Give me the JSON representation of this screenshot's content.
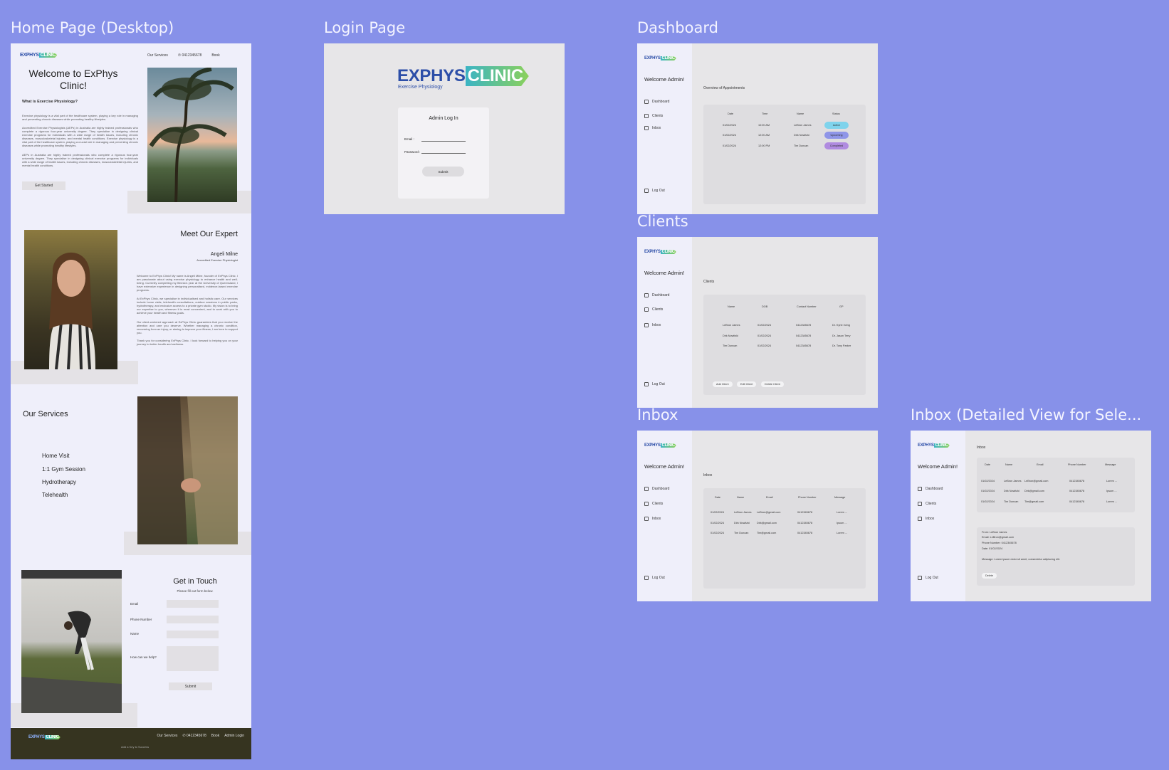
{
  "frames": {
    "home": "Home Page (Desktop)",
    "login": "Login Page",
    "dashboard": "Dashboard",
    "clients": "Clients",
    "inbox": "Inbox",
    "inbox_detail": "Inbox (Detailed View for Sele..."
  },
  "brand": {
    "ex": "EXPHYS",
    "clinic": "CLINIC",
    "sub": "Exercise Physiology"
  },
  "home": {
    "nav": {
      "services": "Our Services",
      "phone": "0412345678",
      "book": "Book"
    },
    "welcome": "Welcome to ExPhys Clinic!",
    "what_is": "What is Exercise Physiology?",
    "para1": "Exercise physiology is a vital part of the healthcare system, playing a key role in managing and preventing chronic diseases while promoting healthy lifestyles.",
    "para2": "Accredited Exercise Physiologists (AEPs) in Australia are highly trained professionals who complete a rigorous four-year university degree. They specialise in designing clinical exercise programs for individuals with a wide range of health issues, including chronic diseases, musculoskeletal injuries, and mental health conditions. Exercise physiology is a vital part of the healthcare system, playing a crucial role in managing and preventing chronic diseases while promoting healthy lifestyles.",
    "para3": "AEPs in Australia are highly trained professionals who complete a rigorous four-year university degree. They specialise in designing clinical exercise programs for individuals with a wide range of health issues, including chronic diseases, musculoskeletal injuries, and mental health conditions.",
    "get_started": "Get Started",
    "meet": "Meet Our Expert",
    "expert_name": "Angeli Milne",
    "expert_title": "Accredited Exercise Physiologist",
    "bio1": "Welcome to ExPhys Clinic! My name is Angeli Milne, founder of ExPhys Clinic. I am passionate about using exercise physiology to enhance health and well-being. Currently completing my fitness's year at the University of Queensland, I have extensive experience in designing personalised, evidence-based exercise programs.",
    "bio2": "At ExPhys Clinic, we specialise in individualised and holistic care. Our services include home visits, telehealth consultations, outdoor sessions in public parks, hydrotherapy, and exclusive access to a private gym studio. My vision is to bring our expertise to you, wherever it is most convenient, and to work with you to achieve your health and fitness goals.",
    "bio3": "Our client-centered approach at ExPhys Clinic guarantees that you receive the attention and care you deserve. Whether managing a chronic condition, recovering from an injury, or aiming to improve your fitness, I am here to support you.",
    "bio4": "Thank you for considering ExPhys Clinic. I look forward to helping you on your journey to better health and wellness.",
    "services_title": "Our Services",
    "services": [
      "Home Visit",
      "1:1 Gym Session",
      "Hydrotherapy",
      "Telehealth"
    ],
    "contact_title": "Get in Touch",
    "contact_sub": "Please fill out form below.",
    "form": {
      "email": "Email",
      "phone": "Phone Number",
      "name": "Name",
      "help": "How can we help?",
      "submit": "Submit"
    },
    "footer": {
      "services": "Our Services",
      "phone": "0412345678",
      "book": "Book",
      "admin": "Admin Login",
      "tagline": "Add a Key to Success"
    }
  },
  "login": {
    "title": "Admin Log In",
    "email": "Email :",
    "password": "Password :",
    "submit": "Submit"
  },
  "admin": {
    "welcome": "Welcome Admin!",
    "nav": [
      "Dashboard",
      "Clients",
      "Inbox"
    ],
    "logout": "Log Out"
  },
  "dashboard": {
    "heading": "Overview of Appointments",
    "headers": [
      "Date",
      "Time",
      "Name",
      "Status"
    ],
    "rows": [
      [
        "01/02/2024",
        "10:00 AM",
        "LeBron James",
        "Active"
      ],
      [
        "01/02/2024",
        "12:00 AM",
        "Dirk Nowitzki",
        "Upcoming"
      ],
      [
        "01/02/2024",
        "12:00 PM",
        "Tim Duncan",
        "Completed"
      ]
    ],
    "status_colors": {
      "Active": "#7fd3ec",
      "Upcoming": "#8f95e8",
      "Completed": "#b08be0"
    }
  },
  "clients": {
    "heading": "Clients",
    "headers": [
      "Name",
      "DOB",
      "Contact Number",
      "GP"
    ],
    "rows": [
      [
        "LeBron James",
        "01/02/2024",
        "0412345678",
        "Dr. Kyrie Irving"
      ],
      [
        "Dirk Nowitzki",
        "01/02/2024",
        "0412345678",
        "Dr. Jason Terry"
      ],
      [
        "Tim Duncan",
        "01/02/2024",
        "0412345678",
        "Dr. Tony Parker"
      ]
    ],
    "buttons": [
      "Add Client",
      "Edit Client",
      "Delete Client"
    ]
  },
  "inbox": {
    "heading": "Inbox",
    "headers": [
      "Date",
      "Name",
      "Email",
      "Phone Number",
      "Message"
    ],
    "rows": [
      [
        "01/02/2024",
        "LeBron James",
        "LeBron@gmail.com",
        "0412345678",
        "Lorem ..."
      ],
      [
        "01/02/2024",
        "Dirk Nowitzki",
        "Dirk@gmail.com",
        "0412345678",
        "Ipsum ..."
      ],
      [
        "01/02/2024",
        "Tim Duncan",
        "Tim@gmail.com",
        "0412345678",
        "Lorem ..."
      ]
    ]
  },
  "detail": {
    "from": "From: LeBron James",
    "email": "Email: LeBron@gmail.com",
    "phone": "Phone Number: 0412345678",
    "date": "Date: 01/02/2024",
    "message": "Message: Lorem ipsum dolor sit amet, consectetur adipiscing elit.",
    "button": "Delete"
  }
}
